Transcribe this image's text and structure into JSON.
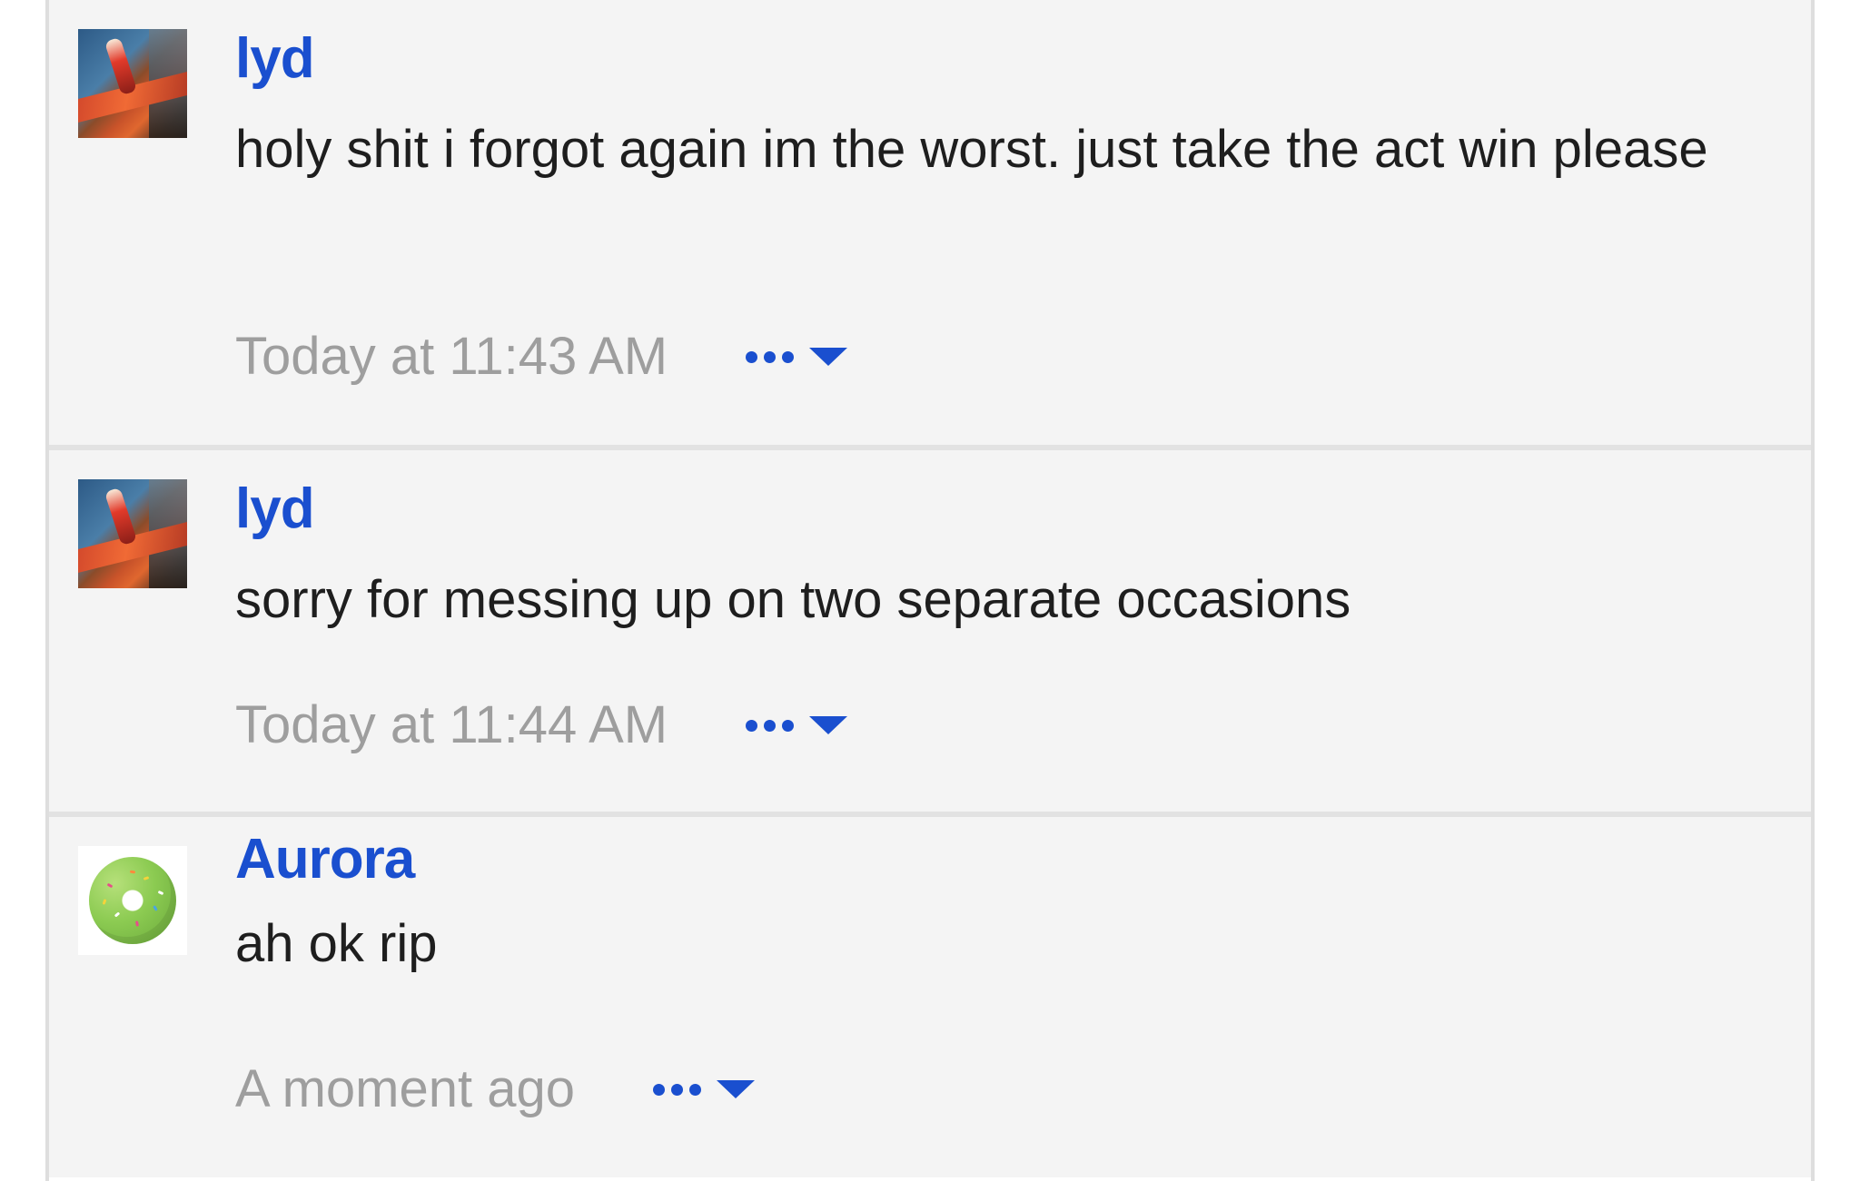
{
  "messages": [
    {
      "username": "lyd",
      "avatar": "rollercoaster-photo-avatar",
      "text": "holy shit i forgot again im the worst. just take the act win please",
      "timestamp": "Today at 11:43 AM",
      "menu_icon": "more-options-icon"
    },
    {
      "username": "lyd",
      "avatar": "rollercoaster-photo-avatar",
      "text": "sorry for messing up on two separate occasions",
      "timestamp": "Today at 11:44 AM",
      "menu_icon": "more-options-icon"
    },
    {
      "username": "Aurora",
      "avatar": "green-donut-avatar",
      "text": "ah ok rip",
      "timestamp": "A moment ago",
      "menu_icon": "more-options-icon"
    }
  ],
  "colors": {
    "accent": "#1a4fcf",
    "timestamp": "#9e9e9e",
    "body_text": "#1e1e1e",
    "message_bg": "#f4f4f4",
    "divider": "#e2e2e2"
  }
}
